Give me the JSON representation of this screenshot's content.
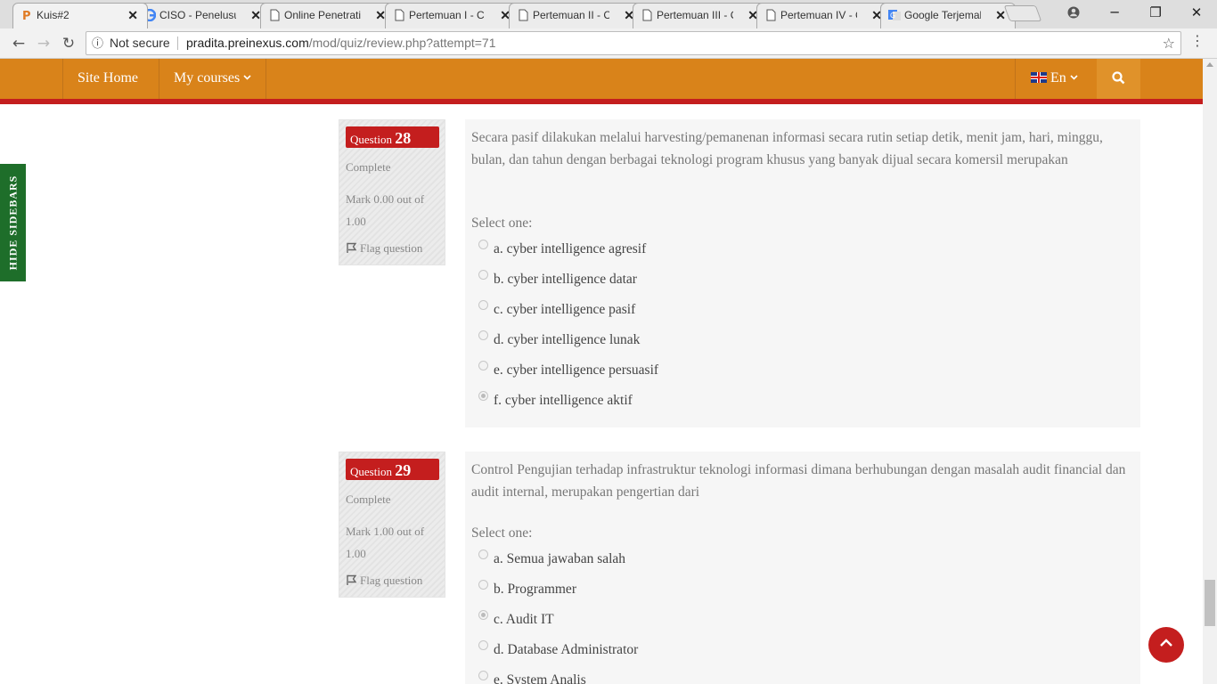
{
  "browser": {
    "tabs": [
      {
        "title": "Kuis#2",
        "icon": "moodle-favicon",
        "active": true
      },
      {
        "title": "CISO - Penelusuran",
        "icon": "google-favicon"
      },
      {
        "title": "Online Penetration",
        "icon": "page-icon"
      },
      {
        "title": "Pertemuan I - C",
        "icon": "page-icon"
      },
      {
        "title": "Pertemuan II - C",
        "icon": "page-icon"
      },
      {
        "title": "Pertemuan III - C",
        "icon": "page-icon"
      },
      {
        "title": "Pertemuan IV - C",
        "icon": "page-icon"
      },
      {
        "title": "Google Terjemahan",
        "icon": "google-translate-favicon"
      }
    ],
    "security": "Not secure",
    "url_domain": "pradita.preinexus.com",
    "url_path": "/mod/quiz/review.php?attempt=71"
  },
  "site_nav": {
    "home": "Site Home",
    "courses": "My courses",
    "language": "En"
  },
  "hide_sidebars": "HIDE SIDEBARS",
  "questions": [
    {
      "label": "Question",
      "number": "28",
      "state": "Complete",
      "mark": "Mark 0.00 out of 1.00",
      "flag": "Flag question",
      "text": "Secara pasif dilakukan melalui harvesting/pemanenan informasi secara rutin setiap detik, menit jam, hari, minggu, bulan, dan tahun dengan berbagai teknologi program khusus yang banyak dijual secara komersil merupakan",
      "prompt": "Select one:",
      "options": [
        "a. cyber intelligence agresif",
        "b. cyber intelligence datar",
        "c. cyber intelligence pasif",
        "d. cyber intelligence lunak",
        "e. cyber intelligence persuasif",
        "f. cyber intelligence aktif"
      ],
      "selected": 5
    },
    {
      "label": "Question",
      "number": "29",
      "state": "Complete",
      "mark": "Mark 1.00 out of 1.00",
      "flag": "Flag question",
      "text": "Control Pengujian terhadap infrastruktur teknologi informasi dimana berhubungan dengan masalah audit financial dan audit internal, merupakan pengertian dari",
      "prompt": "Select one:",
      "options": [
        "a. Semua jawaban salah",
        "b. Programmer",
        "c. Audit IT",
        "d. Database Administrator",
        "e. System Analis"
      ],
      "selected": 2
    }
  ],
  "colors": {
    "nav_orange": "#d9831a",
    "accent_red": "#c41e1e",
    "sidebar_green": "#1e6e2a"
  }
}
